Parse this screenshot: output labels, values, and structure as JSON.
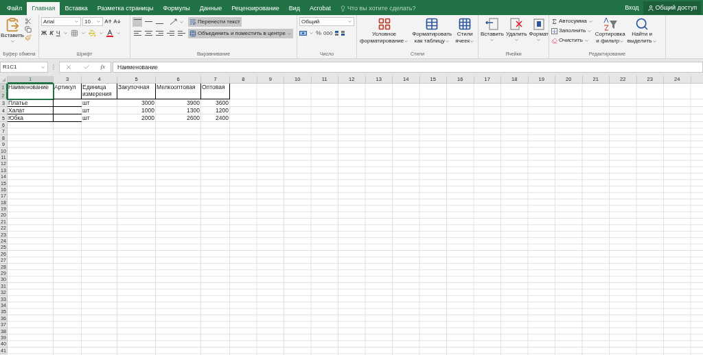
{
  "title_bar": {
    "tabs": [
      {
        "label": "Файл",
        "selected": false
      },
      {
        "label": "Главная",
        "selected": true
      },
      {
        "label": "Вставка",
        "selected": false
      },
      {
        "label": "Разметка страницы",
        "selected": false
      },
      {
        "label": "Формулы",
        "selected": false
      },
      {
        "label": "Данные",
        "selected": false
      },
      {
        "label": "Рецензирование",
        "selected": false
      },
      {
        "label": "Вид",
        "selected": false
      },
      {
        "label": "Acrobat",
        "selected": false
      }
    ],
    "search_placeholder": "Что вы хотите сделать?",
    "sign_in": "Вход",
    "share": "Общий доступ"
  },
  "ribbon": {
    "clipboard": {
      "paste": "Вставить",
      "label": "Буфер обмена"
    },
    "font": {
      "name": "Arial",
      "size": "10",
      "bold": "Ж",
      "italic": "К",
      "underline": "Ч",
      "label": "Шрифт"
    },
    "alignment": {
      "top_align_on": true,
      "wrap": {
        "label": "Перенести текст",
        "on": true
      },
      "merge": {
        "label": "Объединить и поместить в центре",
        "on": true
      },
      "label": "Выравнивание"
    },
    "number": {
      "format": "Общий",
      "percent": "%",
      "thousands": "000",
      "label": "Число"
    },
    "styles": {
      "buttons": [
        {
          "lines": [
            "Условное",
            "форматирование"
          ]
        },
        {
          "lines": [
            "Форматировать",
            "как таблицу"
          ]
        },
        {
          "lines": [
            "Стили",
            "ячеек"
          ]
        }
      ],
      "label": "Стили"
    },
    "cells": {
      "buttons": [
        "Вставить",
        "Удалить",
        "Формат"
      ],
      "label": "Ячейки"
    },
    "editing": {
      "autosum": "Автосумма",
      "fill": "Заполнить",
      "clear": "Очистить",
      "sort": [
        "Сортировка",
        "и фильтр"
      ],
      "find": [
        "Найти и",
        "выделить"
      ],
      "label": "Редактирование"
    }
  },
  "formula_bar": {
    "name_box": "R1C1",
    "function_label": "fx",
    "formula": "Наименование"
  },
  "sheet": {
    "columns": [
      "1",
      "3",
      "4",
      "5",
      "6",
      "7",
      "8",
      "9",
      "10",
      "11",
      "12",
      "13",
      "14",
      "15",
      "16",
      "17",
      "18",
      "19",
      "20",
      "21",
      "22",
      "23",
      "24"
    ],
    "row_count_labels": [
      "1",
      "2",
      "3",
      "4",
      "5",
      "6",
      "7",
      "8",
      "9",
      "10",
      "11",
      "12",
      "13",
      "14",
      "15",
      "16",
      "17",
      "18",
      "19",
      "20",
      "21",
      "22",
      "23",
      "24",
      "25",
      "26",
      "27",
      "28",
      "29",
      "30",
      "31",
      "32",
      "33",
      "34",
      "35",
      "36",
      "37",
      "38",
      "39",
      "40",
      "41"
    ],
    "headers": [
      {
        "text": "Наименование",
        "selected": true
      },
      {
        "text": "Артикул",
        "selected": false
      },
      {
        "text": "Единица измерения",
        "selected": false
      },
      {
        "text": "Закупочная",
        "selected": false
      },
      {
        "text": "Мелкооптовая",
        "selected": false
      },
      {
        "text": "Оптовая",
        "selected": false
      }
    ],
    "rows": [
      {
        "name": "Платье",
        "unit": "шт",
        "prices": [
          "3000",
          "3900",
          "3600"
        ]
      },
      {
        "name": "Халат",
        "unit": "шт",
        "prices": [
          "1000",
          "1300",
          "1200"
        ]
      },
      {
        "name": "Юбка",
        "unit": "шт",
        "prices": [
          "2000",
          "2600",
          "2400"
        ]
      }
    ]
  }
}
